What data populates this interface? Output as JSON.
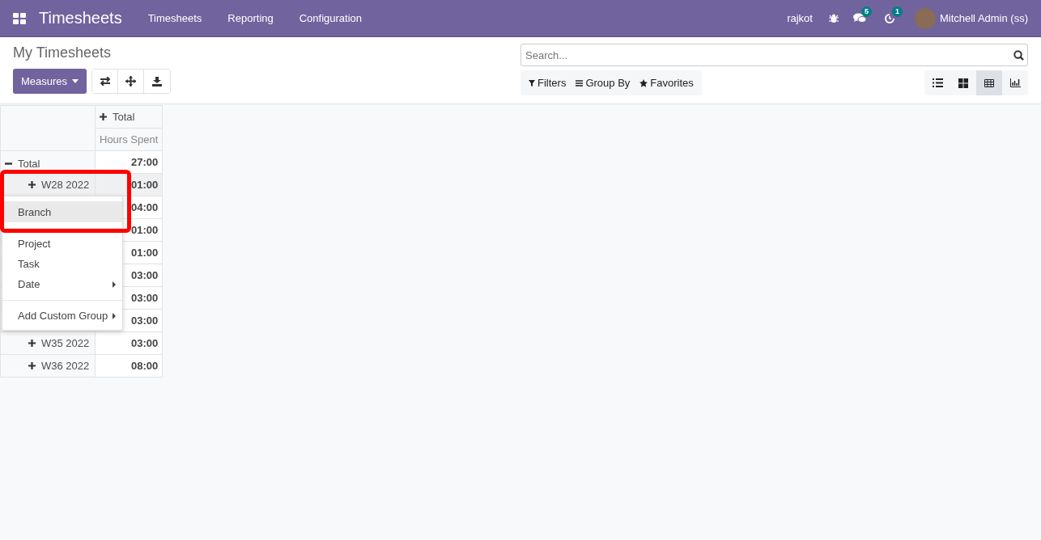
{
  "navbar": {
    "app_title": "Timesheets",
    "menus": [
      "Timesheets",
      "Reporting",
      "Configuration"
    ],
    "company": "rajkot",
    "messages_badge": "5",
    "activities_badge": "1",
    "user": "Mitchell Admin (ss)"
  },
  "control_panel": {
    "title": "My Timesheets",
    "measures_button": "Measures",
    "search": {
      "placeholder": "Search..."
    },
    "search_options": [
      "Filters",
      "Group By",
      "Favorites"
    ],
    "views": [
      {
        "kind": "list",
        "selected": false
      },
      {
        "kind": "kanban",
        "selected": false
      },
      {
        "kind": "pivot",
        "selected": true
      },
      {
        "kind": "graph",
        "selected": false
      }
    ]
  },
  "pivot": {
    "column_header": "Total",
    "measure": "Hours Spent",
    "total_label": "Total",
    "total_value": "27:00",
    "rows": [
      {
        "label": "W28 2022",
        "value": "01:00",
        "hovered": true
      },
      {
        "value": "04:00",
        "hovered": false
      },
      {
        "value": "01:00",
        "hovered": false
      },
      {
        "value": "01:00",
        "hovered": false
      },
      {
        "value": "03:00",
        "hovered": false
      },
      {
        "value": "03:00",
        "hovered": false
      },
      {
        "value": "03:00",
        "hovered": false
      },
      {
        "label": "W35 2022",
        "value": "03:00",
        "hovered": false
      },
      {
        "label": "W36 2022",
        "value": "08:00",
        "hovered": false
      }
    ]
  },
  "group_dropdown": {
    "items": [
      {
        "kind": "option",
        "label": "Branch",
        "selected": true,
        "submenu": false
      },
      {
        "kind": "divider"
      },
      {
        "kind": "option",
        "label": "Project",
        "selected": false,
        "submenu": false
      },
      {
        "kind": "option",
        "label": "Task",
        "selected": false,
        "submenu": false
      },
      {
        "kind": "option",
        "label": "Date",
        "selected": false,
        "submenu": true
      },
      {
        "kind": "divider"
      },
      {
        "kind": "option",
        "label": "Add Custom Group",
        "selected": false,
        "submenu": true
      }
    ]
  },
  "annotation": {
    "highlight_frame": true
  }
}
